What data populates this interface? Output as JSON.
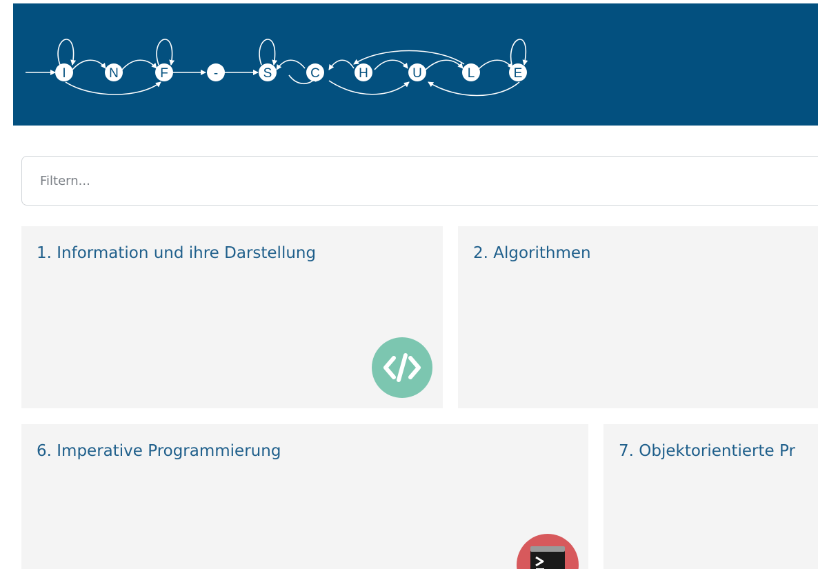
{
  "header": {
    "brand": "INF-SCHULE",
    "logo_letters": [
      "I",
      "N",
      "F",
      "-",
      "S",
      "C",
      "H",
      "U",
      "L",
      "E"
    ]
  },
  "filter": {
    "placeholder": "Filtern..."
  },
  "cards": [
    {
      "title": "1. Information und ihre Darstellung",
      "icon": "code-icon",
      "icon_color": "#7cc6b0"
    },
    {
      "title": "2. Algorithmen"
    },
    {
      "title": "6. Imperative Programmierung",
      "icon": "terminal-icon",
      "icon_color": "#d7595c"
    },
    {
      "title": "7. Objektorientierte Pr"
    }
  ],
  "colors": {
    "header_bg": "#03507f",
    "card_bg": "#f4f4f4",
    "title_text": "#1f5f8b"
  }
}
